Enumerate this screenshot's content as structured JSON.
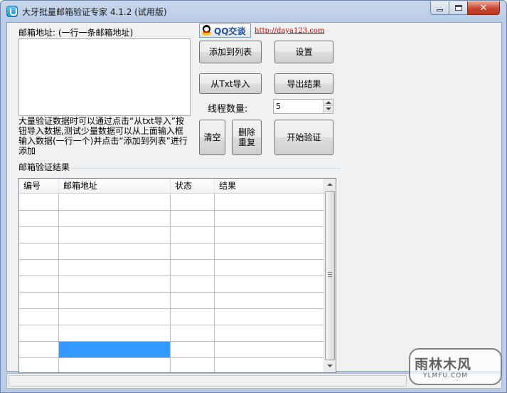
{
  "window": {
    "title": "大牙批量邮箱验证专家 4.1.2 (试用版)"
  },
  "input_panel": {
    "email_label": "邮箱地址: (一行一条邮箱地址)",
    "hint": "大量验证数据时可以通过点击“从txt导入”按钮导入数据,测试少量数据可以从上面输入框输入数据(一行一个)并点击“添加到列表”进行添加"
  },
  "toolbar": {
    "qq_button": "QQ交谈",
    "site_link": "http://daya123.com",
    "add_to_list": "添加到列表",
    "settings": "设置",
    "import_txt": "从Txt导入",
    "export_results": "导出结果",
    "thread_label": "线程数量:",
    "thread_count": "5",
    "clear": "清空",
    "dedupe": "删除重复",
    "start": "开始验证"
  },
  "results": {
    "group_label": "邮箱验证结果",
    "columns": [
      "编号",
      "邮箱地址",
      "状态",
      "结果"
    ],
    "rows": 11,
    "selected_row": 9,
    "selected_column": 1
  },
  "watermark": {
    "main": "雨林木风",
    "sub": "YLMFU.COM"
  },
  "colors": {
    "selection": "#3399ff",
    "link": "#c00000"
  }
}
